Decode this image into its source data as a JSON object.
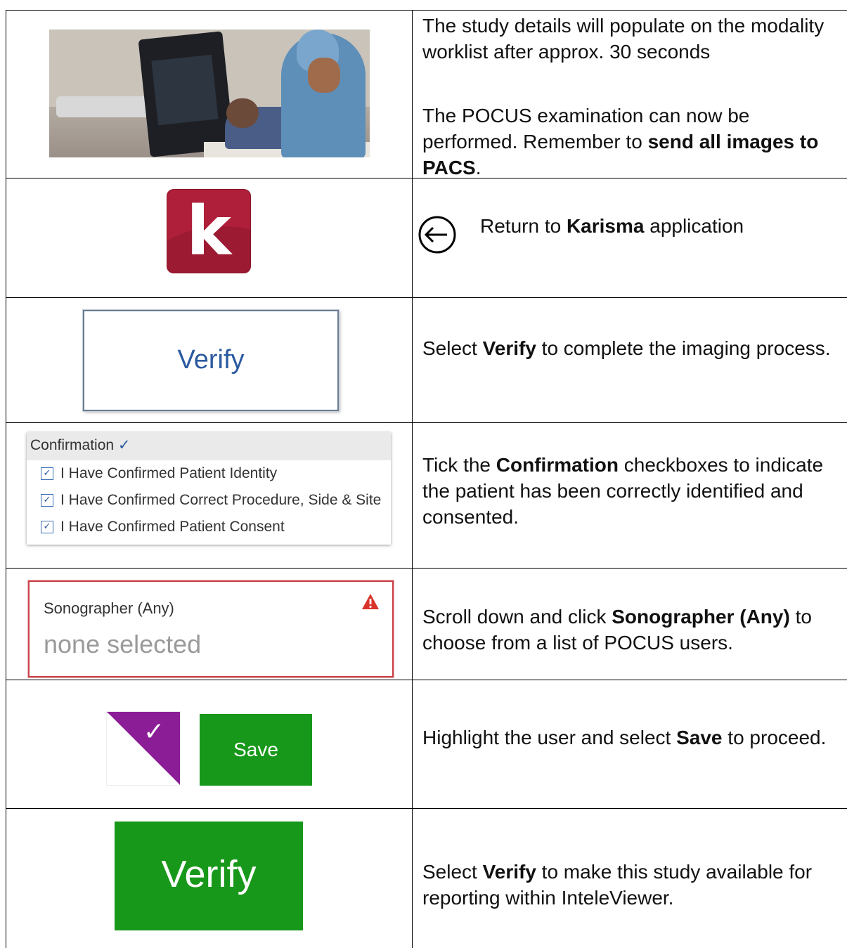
{
  "rows": [
    {
      "text_parts": [
        "The study details will populate on the modality worklist after approx. 30 seconds"
      ],
      "text2_parts": [
        "The POCUS examination can now be performed. Remember to ",
        "send all images to PACS",
        "."
      ]
    },
    {
      "icon_letter": "k",
      "text_parts": [
        "Return to ",
        "Karisma",
        " application"
      ]
    },
    {
      "button_label": "Verify",
      "text_parts": [
        "Select ",
        "Verify",
        " to complete the imaging process."
      ]
    },
    {
      "panel_title": "Confirmation",
      "checkboxes": [
        "I Have Confirmed Patient Identity",
        "I Have Confirmed Correct Procedure, Side & Site",
        "I Have Confirmed Patient Consent"
      ],
      "text_parts": [
        "Tick the ",
        "Confirmation",
        " checkboxes to indicate the patient has been correctly identified and consented."
      ]
    },
    {
      "field_label": "Sonographer (Any)",
      "field_value": "none selected",
      "text_parts": [
        "Scroll down and click ",
        "Sonographer (Any)",
        " to choose from a list of POCUS users."
      ]
    },
    {
      "save_label": "Save",
      "text_parts": [
        "Highlight the user and select ",
        "Save",
        " to proceed."
      ]
    },
    {
      "button_label": "Verify",
      "text_parts": [
        "Select ",
        "Verify",
        " to make this study available for reporting within InteleViewer."
      ]
    }
  ],
  "colors": {
    "karisma_red": "#b01f3a",
    "green": "#18981a",
    "purple": "#8b1e96",
    "verify_blue": "#2c5aa0",
    "warning_red": "#c9434a"
  }
}
